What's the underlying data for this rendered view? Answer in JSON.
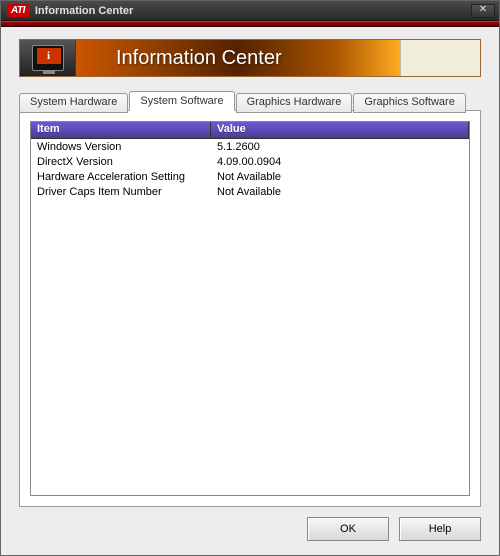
{
  "window": {
    "logo": "ATI",
    "title": "Information Center"
  },
  "banner": {
    "title": "Information Center"
  },
  "tabs": [
    {
      "label": "System Hardware",
      "active": false
    },
    {
      "label": "System Software",
      "active": true
    },
    {
      "label": "Graphics Hardware",
      "active": false
    },
    {
      "label": "Graphics Software",
      "active": false
    }
  ],
  "list": {
    "headers": {
      "item": "Item",
      "value": "Value"
    },
    "rows": [
      {
        "item": "Windows Version",
        "value": "5.1.2600"
      },
      {
        "item": "DirectX Version",
        "value": "4.09.00.0904"
      },
      {
        "item": "Hardware Acceleration Setting",
        "value": "Not Available"
      },
      {
        "item": "Driver Caps Item Number",
        "value": "Not Available"
      }
    ]
  },
  "buttons": {
    "ok": "OK",
    "help": "Help"
  }
}
